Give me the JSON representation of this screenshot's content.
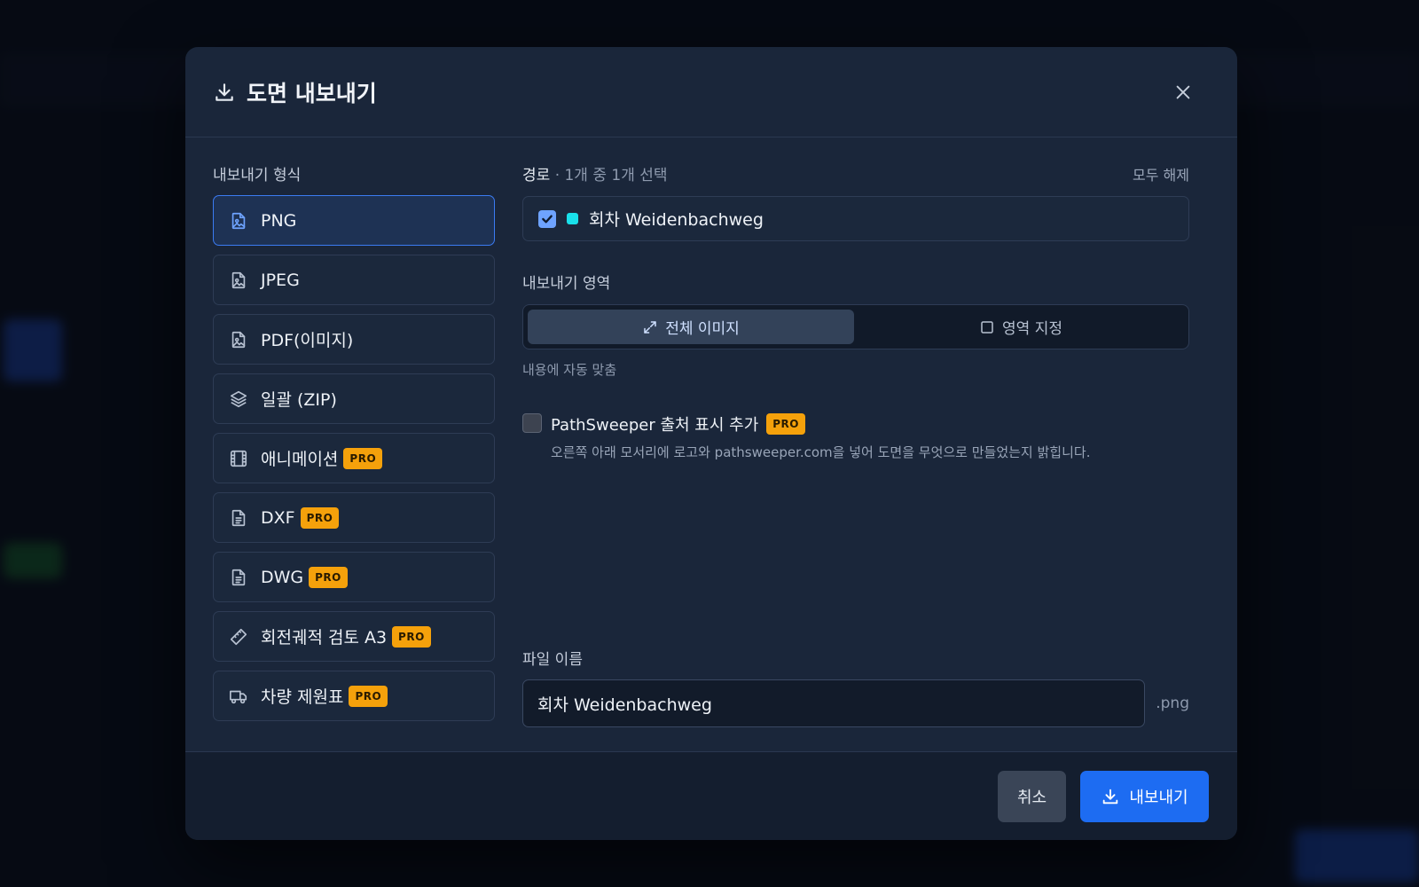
{
  "dialog": {
    "title": "도면 내보내기",
    "close_icon": "close-icon",
    "title_icon": "download-icon"
  },
  "formats": {
    "label": "내보내기 형식",
    "items": [
      {
        "label": "PNG",
        "icon": "image-file-icon",
        "pro": false,
        "selected": true
      },
      {
        "label": "JPEG",
        "icon": "image-file-icon",
        "pro": false
      },
      {
        "label": "PDF(이미지)",
        "icon": "image-file-icon",
        "pro": false
      },
      {
        "label": "일괄 (ZIP)",
        "icon": "layers-icon",
        "pro": false
      },
      {
        "label": "애니메이션",
        "icon": "film-icon",
        "pro": true
      },
      {
        "label": "DXF",
        "icon": "document-icon",
        "pro": true
      },
      {
        "label": "DWG",
        "icon": "document-icon",
        "pro": true
      },
      {
        "label": "회전궤적 검토 A3",
        "icon": "ruler-icon",
        "pro": true
      },
      {
        "label": "차량 제원표",
        "icon": "truck-icon",
        "pro": true
      }
    ],
    "pro_label": "PRO"
  },
  "routes": {
    "label": "경로",
    "count_text": "· 1개 중 1개 선택",
    "deselect_all": "모두 해제",
    "items": [
      {
        "name": "회차 Weidenbachweg",
        "color": "#19e0ea",
        "checked": true
      }
    ]
  },
  "area": {
    "label": "내보내기 영역",
    "options": [
      {
        "label": "전체 이미지",
        "icon": "expand-icon",
        "active": true
      },
      {
        "label": "영역 지정",
        "icon": "square-icon",
        "active": false
      }
    ],
    "hint": "내용에 자동 맞춤"
  },
  "attribution": {
    "label": "PathSweeper 출처 표시 추가",
    "pro_label": "PRO",
    "description": "오른쪽 아래 모서리에 로고와 pathsweeper.com을 넣어 도면을 무엇으로 만들었는지 밝힙니다.",
    "checked": false
  },
  "filename": {
    "label": "파일 이름",
    "value": "회차 Weidenbachweg",
    "extension": ".png"
  },
  "footer": {
    "cancel_label": "취소",
    "export_label": "내보내기"
  },
  "colors": {
    "accent": "#1d6cf2",
    "pro_badge": "#f5a10b",
    "dialog_bg": "#1a263a"
  }
}
